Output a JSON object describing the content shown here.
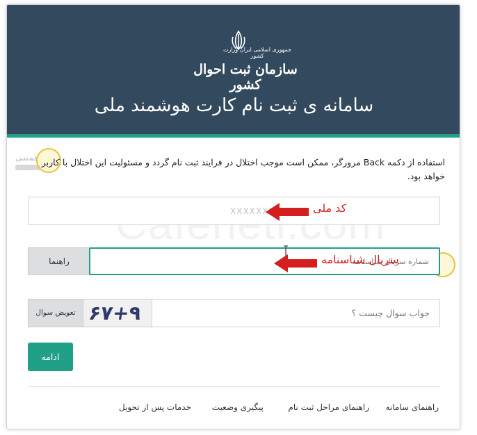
{
  "header": {
    "logo_top": "جمهوری اسلامی ایران وزارت کشور",
    "logo_main": "سازمان ثبت احوال کشور",
    "title": "سامانه ی ثبت نام کارت هوشمند ملی"
  },
  "notice": "استفاده از دکمه Back مرورگر، ممکن است موجب اختلال در فرایند ثبت نام گردد و مسئولیت این اختلال با کاربر خواهد بود.",
  "watermark": "Cafeneti.com",
  "badges": {
    "brand": "کافه‌نتی"
  },
  "form": {
    "national_code_value": "XXXXXXXX",
    "national_code_annotation": "کد ملی",
    "serial_placeholder": "شماره سریال شناسنامه",
    "serial_annotation": "سریال شناسنامه",
    "help_button": "راهنما",
    "captcha_refresh": "تعویض سوال",
    "captcha_text": "۶۷+۹",
    "captcha_placeholder": "جواب سوال چیست ؟",
    "continue_button": "ادامه"
  },
  "footer": {
    "links": [
      "راهنمای سامانه",
      "راهنمای مراحل ثبت نام",
      "پیگیری وضعیت",
      "خدمات پس از تحویل"
    ]
  },
  "colors": {
    "header_bg": "#33495e",
    "accent": "#1fa087",
    "annotation": "#d51f1f"
  }
}
